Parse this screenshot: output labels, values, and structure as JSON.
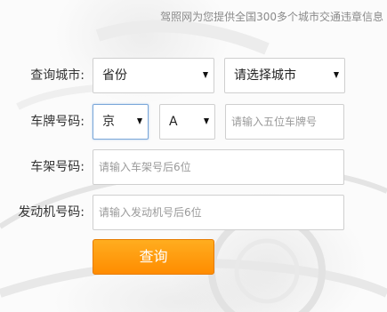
{
  "tagline": "驾照网为您提供全国300多个城市交通违章信息",
  "form": {
    "city": {
      "label": "查询城市:",
      "province_value": "省份",
      "city_value": "请选择城市"
    },
    "plate": {
      "label": "车牌号码:",
      "region_value": "京",
      "letter_value": "A",
      "placeholder": "请输入五位车牌号"
    },
    "frame": {
      "label": "车架号码:",
      "placeholder": "请输入车架号后6位"
    },
    "engine": {
      "label": "发动机号码:",
      "placeholder": "请输入发动机号后6位"
    },
    "submit_label": "查询"
  },
  "colors": {
    "accent": "#ff9a0f",
    "focus_border": "#7aa7d9"
  }
}
